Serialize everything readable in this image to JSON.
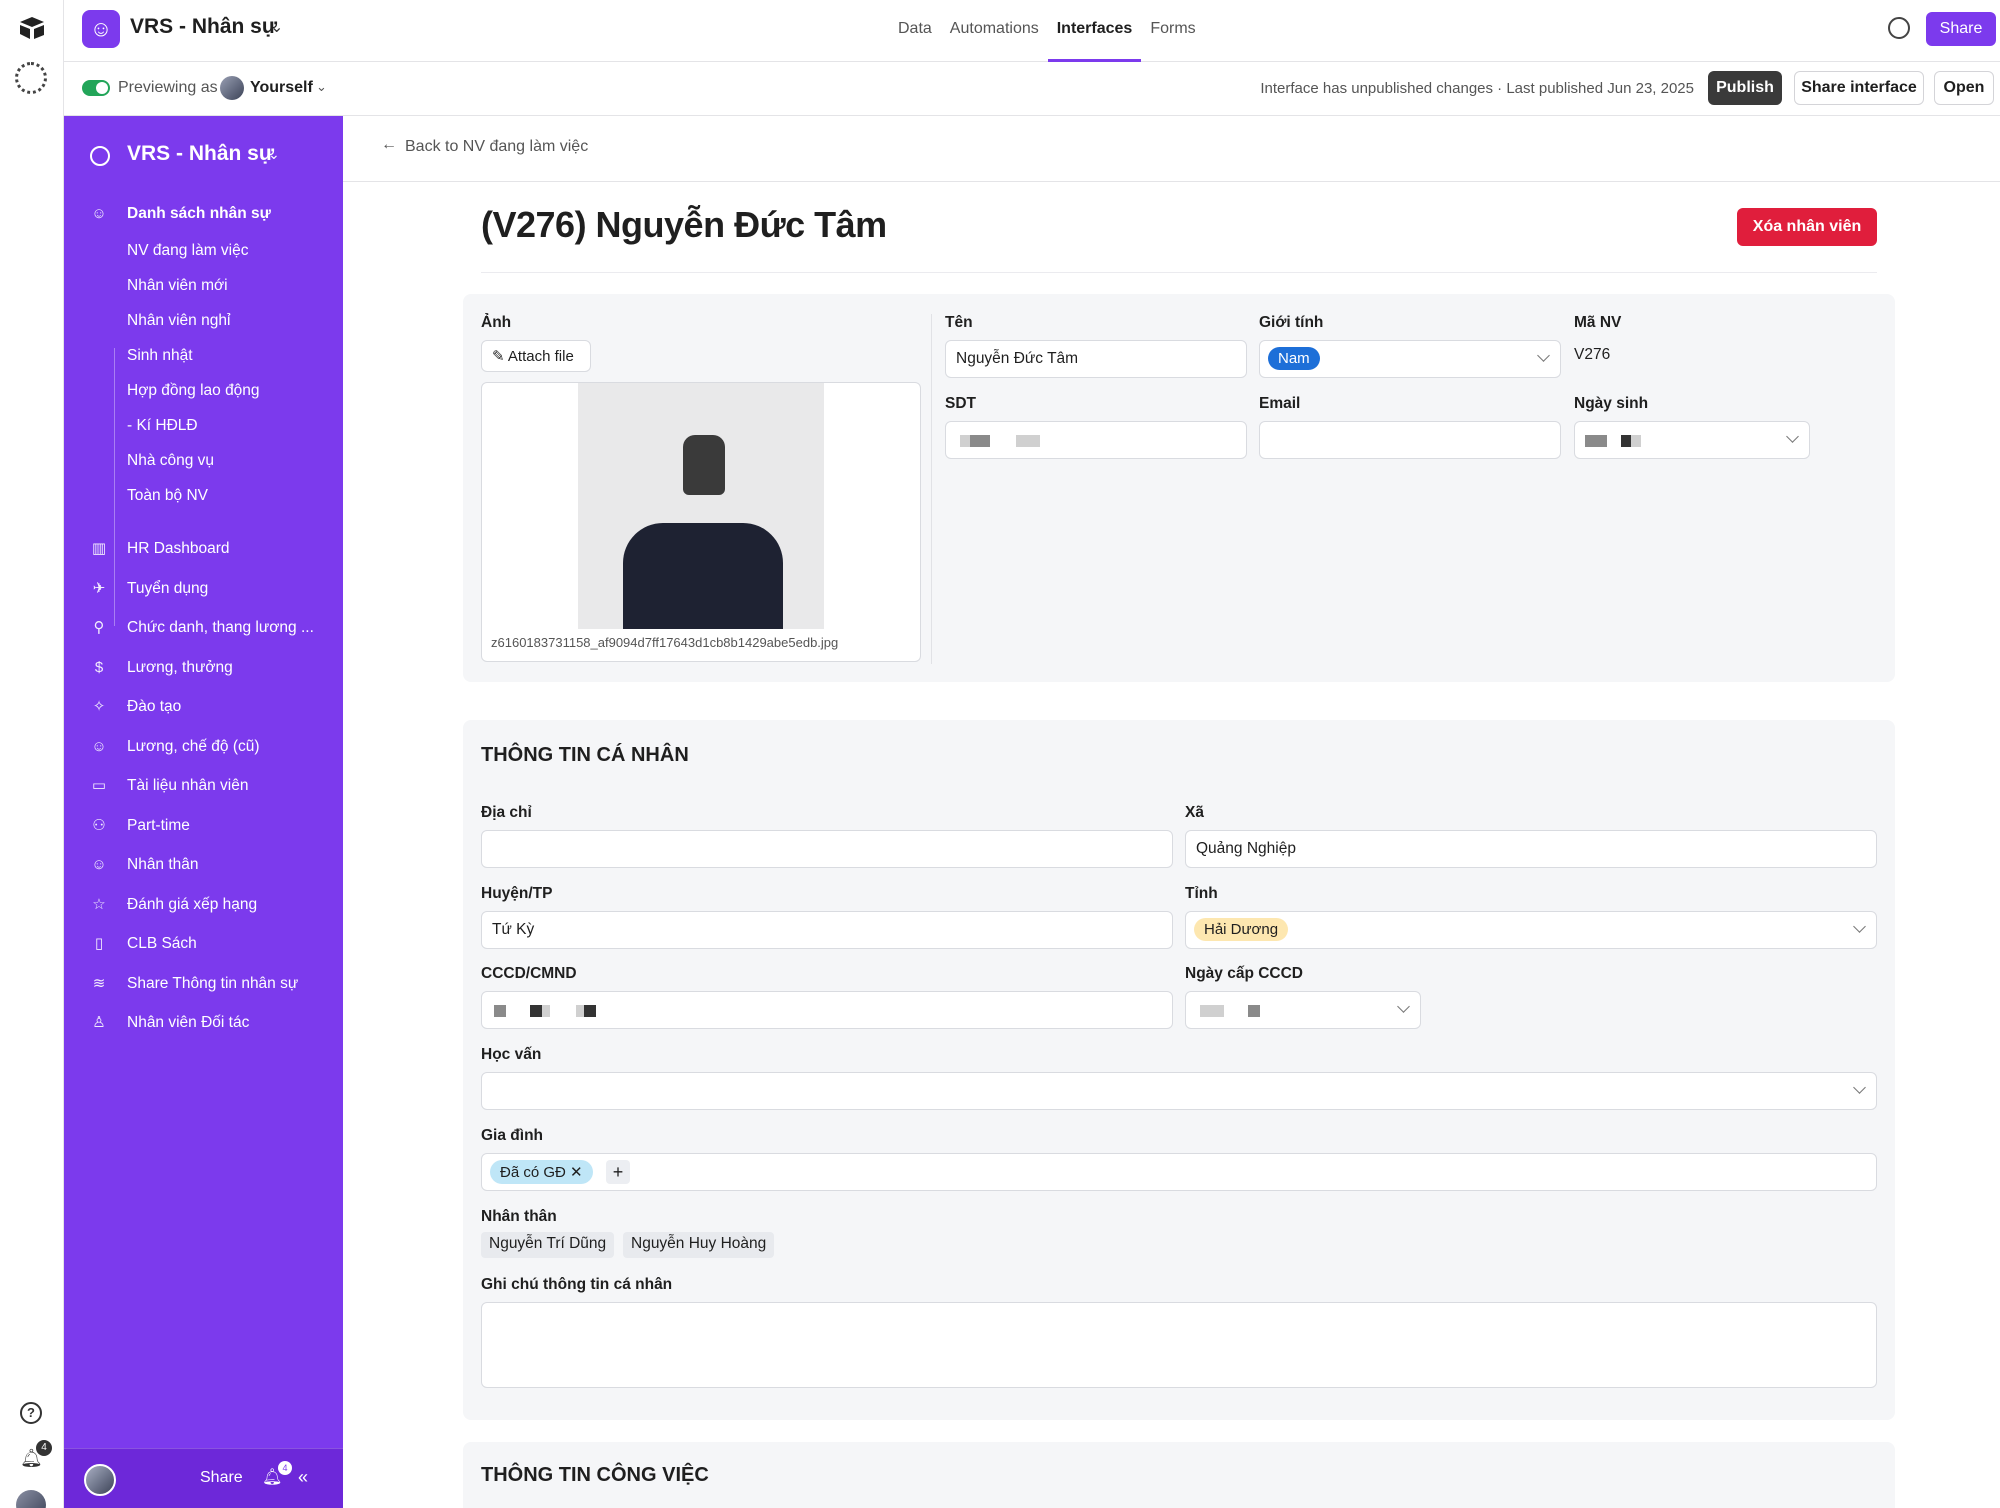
{
  "topbar": {
    "app_name": "VRS - Nhân sự",
    "tabs": [
      "Data",
      "Automations",
      "Interfaces",
      "Forms"
    ],
    "active_tab": "Interfaces",
    "share_label": "Share"
  },
  "preview": {
    "label": "Previewing as",
    "user": "Yourself",
    "status": "Interface has unpublished changes · Last published Jun 23, 2025",
    "publish_label": "Publish",
    "share_interface_label": "Share interface",
    "open_label": "Open"
  },
  "rail": {
    "help_glyph": "?",
    "notification_count": "4"
  },
  "sidebar": {
    "title": "VRS - Nhân sự",
    "group_label": "Danh sách nhân sự",
    "sub_items": [
      "NV đang làm việc",
      "Nhân viên mới",
      "Nhân viên nghỉ",
      "Sinh nhật",
      "Hợp đồng lao động",
      "- Kí HĐLĐ",
      "Nhà công vụ",
      "Toàn bộ NV"
    ],
    "items": [
      {
        "label": "HR Dashboard",
        "icon": "bar-chart-icon",
        "glyph": "▥"
      },
      {
        "label": "Tuyển dụng",
        "icon": "plane-icon",
        "glyph": "✈"
      },
      {
        "label": "Chức danh, thang lương ...",
        "icon": "hierarchy-icon",
        "glyph": "⚲"
      },
      {
        "label": "Lương, thưởng",
        "icon": "dollar-icon",
        "glyph": "$"
      },
      {
        "label": "Đào tạo",
        "icon": "lightbulb-icon",
        "glyph": "✧"
      },
      {
        "label": "Lương, chế độ (cũ)",
        "icon": "smiley-icon",
        "glyph": "☺"
      },
      {
        "label": "Tài liệu nhân viên",
        "icon": "folder-icon",
        "glyph": "▭"
      },
      {
        "label": "Part-time",
        "icon": "users-icon",
        "glyph": "⚇"
      },
      {
        "label": "Nhân thân",
        "icon": "smiley-icon",
        "glyph": "☺"
      },
      {
        "label": "Đánh giá xếp hạng",
        "icon": "star-icon",
        "glyph": "☆"
      },
      {
        "label": "CLB Sách",
        "icon": "book-icon",
        "glyph": "▯"
      },
      {
        "label": "Share Thông tin nhân sự",
        "icon": "rss-icon",
        "glyph": "≋"
      },
      {
        "label": "Nhân viên Đối tác",
        "icon": "user-icon",
        "glyph": "♙"
      }
    ],
    "footer_share": "Share",
    "footer_badge": "4"
  },
  "record": {
    "back_label": "Back to NV đang làm việc",
    "title": "(V276) Nguyễn Đức Tâm",
    "delete_label": "Xóa nhân viên",
    "photo_label": "Ảnh",
    "attach_label": "Attach file",
    "photo_filename": "z6160183731158_af9094d7ff17643d1cb8b1429abe5edb.jpg",
    "name_label": "Tên",
    "name_value": "Nguyễn Đức Tâm",
    "gender_label": "Giới tính",
    "gender_value": "Nam",
    "code_label": "Mã NV",
    "code_value": "V276",
    "phone_label": "SDT",
    "email_label": "Email",
    "email_value": "",
    "dob_label": "Ngày sinh"
  },
  "personal": {
    "heading": "THÔNG TIN CÁ NHÂN",
    "address_label": "Địa chỉ",
    "address_value": "",
    "commune_label": "Xã",
    "commune_value": "Quảng Nghiệp",
    "district_label": "Huyện/TP",
    "district_value": "Tứ Kỳ",
    "province_label": "Tỉnh",
    "province_value": "Hải Dương",
    "id_label": "CCCD/CMND",
    "id_date_label": "Ngày cấp CCCD",
    "education_label": "Học vấn",
    "family_label": "Gia đình",
    "family_tag": "Đã có GĐ",
    "relatives_label": "Nhân thân",
    "relatives": [
      "Nguyễn Trí Dũng",
      "Nguyễn Huy Hoàng"
    ],
    "notes_label": "Ghi chú thông tin cá nhân"
  },
  "work": {
    "heading": "THÔNG TIN CÔNG VIỆC"
  },
  "colors": {
    "brand": "#7c3aed",
    "danger": "#e01e3c",
    "gender_pill": "#1d6fd8",
    "province_pill": "#fde7b0",
    "family_pill": "#bfe6f7"
  }
}
